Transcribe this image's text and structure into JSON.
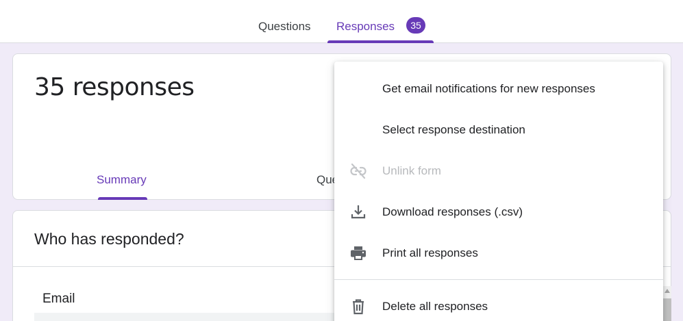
{
  "tabs": {
    "questions": "Questions",
    "responses": "Responses",
    "responses_count": "35"
  },
  "summary_card": {
    "title": "35 responses",
    "tabs": {
      "summary": "Summary",
      "question": "Que"
    }
  },
  "who_card": {
    "title": "Who has responded?",
    "email_label": "Email"
  },
  "menu": {
    "items": [
      {
        "label": "Get email notifications for new responses",
        "icon": "none"
      },
      {
        "label": "Select response destination",
        "icon": "none"
      },
      {
        "label": "Unlink form",
        "icon": "link-off-icon",
        "disabled": true
      },
      {
        "label": "Download responses (.csv)",
        "icon": "download-icon"
      },
      {
        "label": "Print all responses",
        "icon": "print-icon"
      },
      {
        "label": "Delete all responses",
        "icon": "trash-icon"
      }
    ]
  },
  "colors": {
    "accent": "#673ab7",
    "background": "#f0ebf8",
    "disabled": "#b7b9bc"
  }
}
